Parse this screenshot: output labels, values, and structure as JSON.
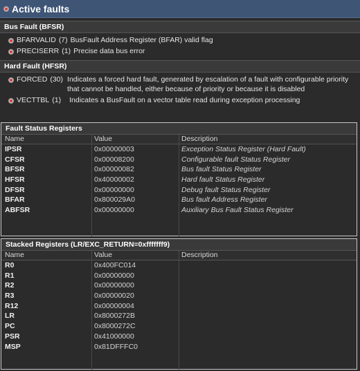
{
  "title": "Active faults",
  "bus_fault": {
    "header": "Bus Fault (BFSR)",
    "items": [
      {
        "name": "BFARVALID",
        "code": "(7)",
        "desc": "BusFault Address Register (BFAR) valid flag"
      },
      {
        "name": "PRECISERR",
        "code": "(1)",
        "desc": "Precise data bus error"
      }
    ]
  },
  "hard_fault": {
    "header": "Hard Fault (HFSR)",
    "items": [
      {
        "name": "FORCED",
        "code": "(30)",
        "desc": "Indicates a forced hard fault, generated by escalation of a fault with configurable priority that cannot be handled, either because of priority or because it is disabled"
      },
      {
        "name": "VECTTBL",
        "code": "(1)",
        "desc": "Indicates a BusFault on a vector table read during exception processing"
      }
    ]
  },
  "fault_status": {
    "header": "Fault Status Registers",
    "columns": [
      "Name",
      "Value",
      "Description"
    ],
    "rows": [
      {
        "name": "IPSR",
        "value": "0x00000003",
        "desc": "Exception Status Register (Hard Fault)"
      },
      {
        "name": "CFSR",
        "value": "0x00008200",
        "desc": "Configurable fault Status Register"
      },
      {
        "name": "BFSR",
        "value": "0x00000082",
        "desc": "Bus fault Status Register"
      },
      {
        "name": "HFSR",
        "value": "0x40000002",
        "desc": "Hard fault Status Register"
      },
      {
        "name": "DFSR",
        "value": "0x00000000",
        "desc": "Debug fault Status Register"
      },
      {
        "name": "BFAR",
        "value": "0x800029A0",
        "desc": "Bus fault Address Register"
      },
      {
        "name": "ABFSR",
        "value": "0x00000000",
        "desc": "Auxiliary Bus Fault Status Register"
      }
    ]
  },
  "stacked": {
    "header": "Stacked Registers (LR/EXC_RETURN=0xfffffff9)",
    "columns": [
      "Name",
      "Value",
      "Description"
    ],
    "rows": [
      {
        "name": "R0",
        "value": "0x400FC014",
        "desc": ""
      },
      {
        "name": "R1",
        "value": "0x00000000",
        "desc": ""
      },
      {
        "name": "R2",
        "value": "0x00000000",
        "desc": ""
      },
      {
        "name": "R3",
        "value": "0x00000020",
        "desc": ""
      },
      {
        "name": "R12",
        "value": "0x00000004",
        "desc": ""
      },
      {
        "name": "LR",
        "value": "0x8000272B",
        "desc": ""
      },
      {
        "name": "PC",
        "value": "0x8000272C",
        "desc": ""
      },
      {
        "name": "PSR",
        "value": "0x41000000",
        "desc": ""
      },
      {
        "name": "MSP",
        "value": "0x81DFFFC0",
        "desc": ""
      }
    ]
  }
}
